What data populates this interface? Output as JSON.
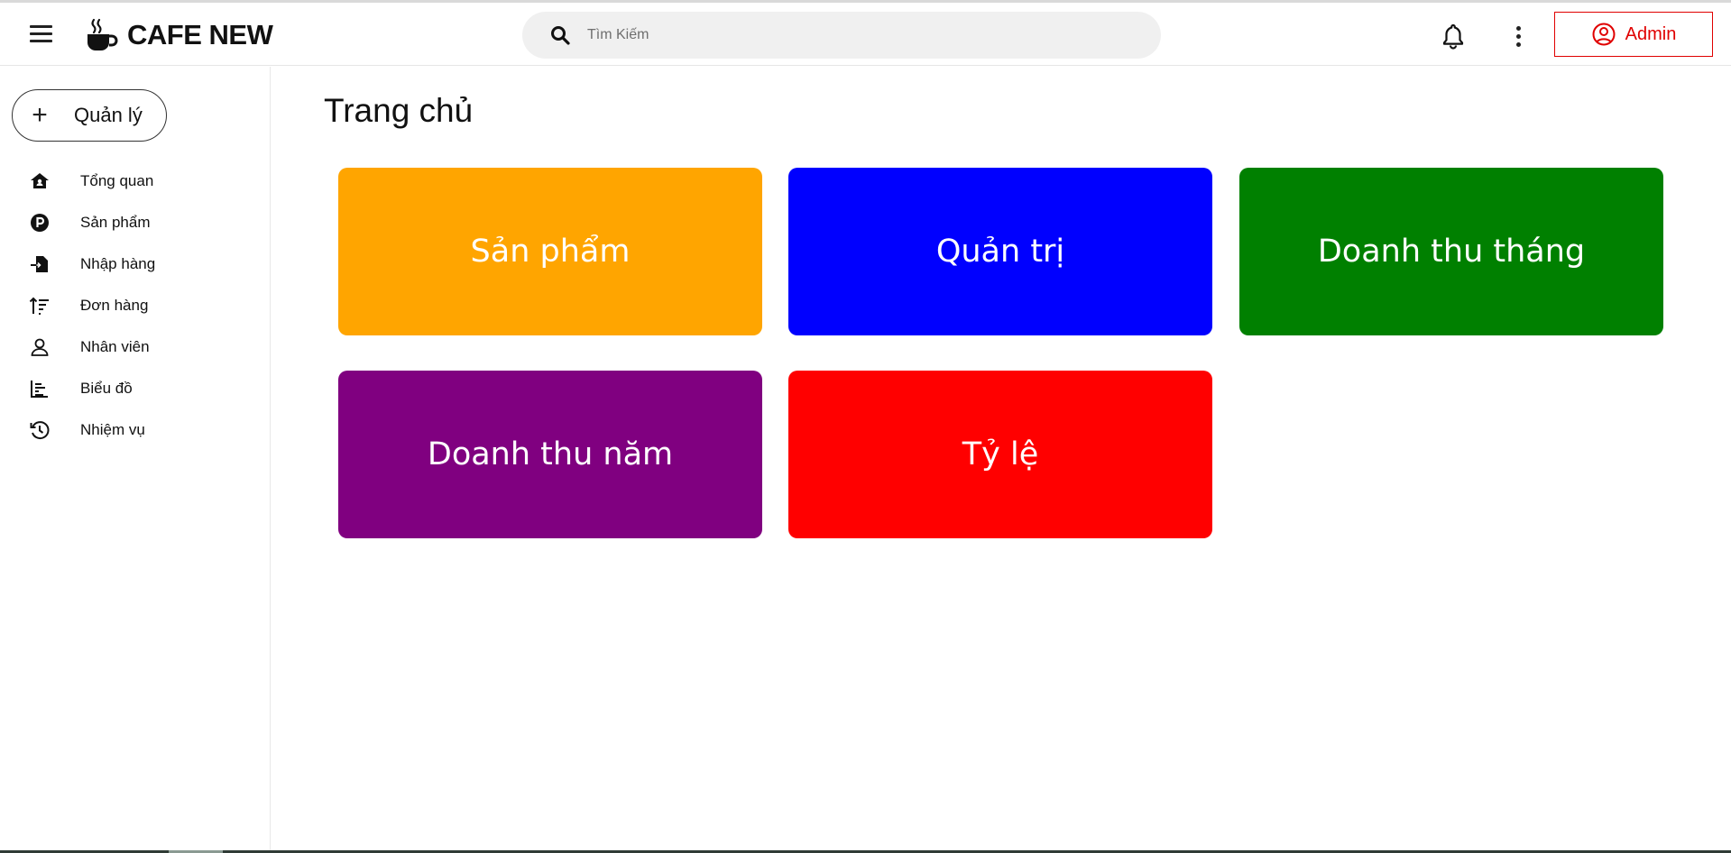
{
  "header": {
    "brand": "CAFE NEW",
    "search_placeholder": "Tìm Kiếm",
    "admin_label": "Admin"
  },
  "sidebar": {
    "manage_label": "Quản lý",
    "items": [
      {
        "label": "Tổng quan",
        "icon": "home-icon"
      },
      {
        "label": "Sản phẩm",
        "icon": "product-p-icon"
      },
      {
        "label": "Nhập hàng",
        "icon": "import-icon"
      },
      {
        "label": "Đơn hàng",
        "icon": "sort-orders-icon"
      },
      {
        "label": "Nhân viên",
        "icon": "person-icon"
      },
      {
        "label": "Biểu đồ",
        "icon": "chart-icon"
      },
      {
        "label": "Nhiệm vụ",
        "icon": "history-icon"
      }
    ]
  },
  "main": {
    "title": "Trang chủ",
    "cards": [
      {
        "label": "Sản phẩm",
        "color": "#FFA500"
      },
      {
        "label": "Quản trị",
        "color": "#0000FF"
      },
      {
        "label": "Doanh thu tháng",
        "color": "#008000"
      },
      {
        "label": "Doanh thu năm",
        "color": "#800080"
      },
      {
        "label": "Tỷ lệ",
        "color": "#FF0000"
      }
    ]
  },
  "colors": {
    "accent": "#e00000",
    "search_bg": "#f0f0f0"
  }
}
